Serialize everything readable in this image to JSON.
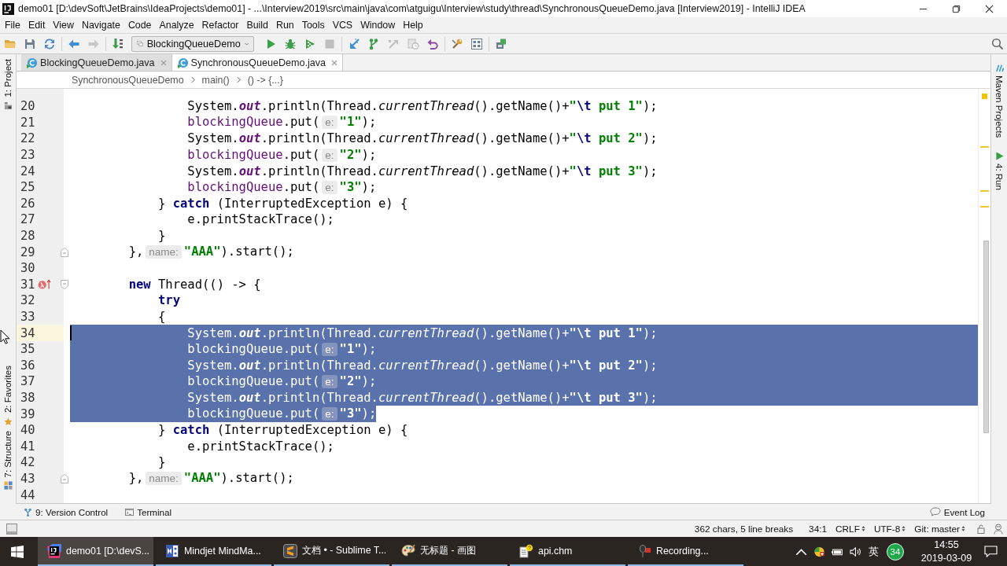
{
  "window": {
    "title": "demo01 [D:\\devSoft\\JetBrains\\IdeaProjects\\demo01] - ...\\Interview2019\\src\\main\\java\\com\\atguigu\\Interview\\study\\thread\\SynchronousQueueDemo.java [Interview2019] - IntelliJ IDEA"
  },
  "menu": [
    "File",
    "Edit",
    "View",
    "Navigate",
    "Code",
    "Analyze",
    "Refactor",
    "Build",
    "Run",
    "Tools",
    "VCS",
    "Window",
    "Help"
  ],
  "toolbar": {
    "run_config": "BlockingQueueDemo"
  },
  "left_tool_strip": {
    "top": [
      {
        "label": "1: Project",
        "kind": "project"
      }
    ],
    "bottom": [
      {
        "label": "2: Favorites",
        "kind": "favorites"
      },
      {
        "label": "7: Structure",
        "kind": "structure"
      }
    ]
  },
  "editor_tabs": [
    {
      "label": "BlockingQueueDemo.java",
      "selected": false
    },
    {
      "label": "SynchronousQueueDemo.java",
      "selected": true
    }
  ],
  "breadcrumbs": [
    "SynchronousQueueDemo",
    "main()",
    "() -> {...}"
  ],
  "editor": {
    "lines": [
      {
        "number": "20",
        "selected": false,
        "current": false,
        "tokens": [
          {
            "text": "                System.",
            "kind": "plain"
          },
          {
            "text": "out",
            "kind": "field"
          },
          {
            "text": ".println(Thread.",
            "kind": "plain"
          },
          {
            "text": "currentThread",
            "kind": "static"
          },
          {
            "text": "().getName()+",
            "kind": "plain"
          },
          {
            "text": "\"",
            "kind": "string"
          },
          {
            "text": "\\t",
            "kind": "escape"
          },
          {
            "text": " put 1\"",
            "kind": "string"
          },
          {
            "text": ");",
            "kind": "plain"
          }
        ]
      },
      {
        "number": "21",
        "selected": false,
        "current": false,
        "tokens": [
          {
            "text": "                blockingQueue",
            "kind": "captured"
          },
          {
            "text": ".put(",
            "kind": "plain"
          },
          {
            "text": "e:",
            "kind": "hint"
          },
          {
            "text": "\"1\"",
            "kind": "string"
          },
          {
            "text": ");",
            "kind": "plain"
          }
        ]
      },
      {
        "number": "22",
        "selected": false,
        "current": false,
        "tokens": [
          {
            "text": "                System.",
            "kind": "plain"
          },
          {
            "text": "out",
            "kind": "field"
          },
          {
            "text": ".println(Thread.",
            "kind": "plain"
          },
          {
            "text": "currentThread",
            "kind": "static"
          },
          {
            "text": "().getName()+",
            "kind": "plain"
          },
          {
            "text": "\"",
            "kind": "string"
          },
          {
            "text": "\\t",
            "kind": "escape"
          },
          {
            "text": " put 2\"",
            "kind": "string"
          },
          {
            "text": ");",
            "kind": "plain"
          }
        ]
      },
      {
        "number": "23",
        "selected": false,
        "current": false,
        "tokens": [
          {
            "text": "                blockingQueue",
            "kind": "captured"
          },
          {
            "text": ".put(",
            "kind": "plain"
          },
          {
            "text": "e:",
            "kind": "hint"
          },
          {
            "text": "\"2\"",
            "kind": "string"
          },
          {
            "text": ");",
            "kind": "plain"
          }
        ]
      },
      {
        "number": "24",
        "selected": false,
        "current": false,
        "tokens": [
          {
            "text": "                System.",
            "kind": "plain"
          },
          {
            "text": "out",
            "kind": "field"
          },
          {
            "text": ".println(Thread.",
            "kind": "plain"
          },
          {
            "text": "currentThread",
            "kind": "static"
          },
          {
            "text": "().getName()+",
            "kind": "plain"
          },
          {
            "text": "\"",
            "kind": "string"
          },
          {
            "text": "\\t",
            "kind": "escape"
          },
          {
            "text": " put 3\"",
            "kind": "string"
          },
          {
            "text": ");",
            "kind": "plain"
          }
        ]
      },
      {
        "number": "25",
        "selected": false,
        "current": false,
        "tokens": [
          {
            "text": "                blockingQueue",
            "kind": "captured"
          },
          {
            "text": ".put(",
            "kind": "plain"
          },
          {
            "text": "e:",
            "kind": "hint"
          },
          {
            "text": "\"3\"",
            "kind": "string"
          },
          {
            "text": ");",
            "kind": "plain"
          }
        ]
      },
      {
        "number": "26",
        "selected": false,
        "current": false,
        "tokens": [
          {
            "text": "            } ",
            "kind": "plain"
          },
          {
            "text": "catch",
            "kind": "keyword"
          },
          {
            "text": " (InterruptedException e) {",
            "kind": "plain"
          }
        ]
      },
      {
        "number": "27",
        "selected": false,
        "current": false,
        "tokens": [
          {
            "text": "                e.printStackTrace();",
            "kind": "plain"
          }
        ]
      },
      {
        "number": "28",
        "selected": false,
        "current": false,
        "tokens": [
          {
            "text": "            }",
            "kind": "plain"
          }
        ]
      },
      {
        "number": "29",
        "selected": false,
        "current": false,
        "gutter_icons": [
          {
            "kind": "fold_end"
          }
        ],
        "tokens": [
          {
            "text": "        },",
            "kind": "plain"
          },
          {
            "text": "name:",
            "kind": "hint"
          },
          {
            "text": "\"AAA\"",
            "kind": "string"
          },
          {
            "text": ").start();",
            "kind": "plain"
          }
        ]
      },
      {
        "number": "30",
        "selected": false,
        "current": false
      },
      {
        "number": "31",
        "selected": false,
        "current": false,
        "gutter_icons": [
          {
            "kind": "lambda"
          },
          {
            "kind": "fold_start"
          }
        ],
        "tokens": [
          {
            "text": "        new",
            "kind": "keyword"
          },
          {
            "text": " Thread(() -> {",
            "kind": "plain"
          }
        ]
      },
      {
        "number": "32",
        "selected": false,
        "current": false,
        "tokens": [
          {
            "text": "            try",
            "kind": "keyword"
          }
        ]
      },
      {
        "number": "33",
        "selected": false,
        "current": false,
        "tokens": [
          {
            "text": "            {",
            "kind": "plain"
          }
        ]
      },
      {
        "number": "34",
        "selected": true,
        "current": true,
        "tokens": [
          {
            "text": "                System.",
            "kind": "plain"
          },
          {
            "text": "out",
            "kind": "field"
          },
          {
            "text": ".println(Thread.",
            "kind": "plain"
          },
          {
            "text": "currentThread",
            "kind": "static"
          },
          {
            "text": "().getName()+",
            "kind": "plain"
          },
          {
            "text": "\"",
            "kind": "string"
          },
          {
            "text": "\\t",
            "kind": "escape"
          },
          {
            "text": " put 1\"",
            "kind": "string"
          },
          {
            "text": ");",
            "kind": "plain"
          }
        ]
      },
      {
        "number": "35",
        "selected": true,
        "current": false,
        "tokens": [
          {
            "text": "                blockingQueue",
            "kind": "captured"
          },
          {
            "text": ".put(",
            "kind": "plain"
          },
          {
            "text": "e:",
            "kind": "hint"
          },
          {
            "text": "\"1\"",
            "kind": "string"
          },
          {
            "text": ");",
            "kind": "plain"
          }
        ]
      },
      {
        "number": "36",
        "selected": true,
        "current": false,
        "tokens": [
          {
            "text": "                System.",
            "kind": "plain"
          },
          {
            "text": "out",
            "kind": "field"
          },
          {
            "text": ".println(Thread.",
            "kind": "plain"
          },
          {
            "text": "currentThread",
            "kind": "static"
          },
          {
            "text": "().getName()+",
            "kind": "plain"
          },
          {
            "text": "\"",
            "kind": "string"
          },
          {
            "text": "\\t",
            "kind": "escape"
          },
          {
            "text": " put 2\"",
            "kind": "string"
          },
          {
            "text": ");",
            "kind": "plain"
          }
        ]
      },
      {
        "number": "37",
        "selected": true,
        "current": false,
        "tokens": [
          {
            "text": "                blockingQueue",
            "kind": "captured"
          },
          {
            "text": ".put(",
            "kind": "plain"
          },
          {
            "text": "e:",
            "kind": "hint"
          },
          {
            "text": "\"2\"",
            "kind": "string"
          },
          {
            "text": ");",
            "kind": "plain"
          }
        ]
      },
      {
        "number": "38",
        "selected": true,
        "current": false,
        "tokens": [
          {
            "text": "                System.",
            "kind": "plain"
          },
          {
            "text": "out",
            "kind": "field"
          },
          {
            "text": ".println(Thread.",
            "kind": "plain"
          },
          {
            "text": "currentThread",
            "kind": "static"
          },
          {
            "text": "().getName()+",
            "kind": "plain"
          },
          {
            "text": "\"",
            "kind": "string"
          },
          {
            "text": "\\t",
            "kind": "escape"
          },
          {
            "text": " put 3\"",
            "kind": "string"
          },
          {
            "text": ");",
            "kind": "plain"
          }
        ]
      },
      {
        "number": "39",
        "selected": true,
        "current": false,
        "tokens": [
          {
            "text": "                blockingQueue",
            "kind": "captured"
          },
          {
            "text": ".put(",
            "kind": "plain"
          },
          {
            "text": "e:",
            "kind": "hint"
          },
          {
            "text": "\"3\"",
            "kind": "string"
          },
          {
            "text": ");",
            "kind": "plain"
          }
        ]
      },
      {
        "number": "40",
        "selected": false,
        "current": false,
        "tokens": [
          {
            "text": "            } ",
            "kind": "plain"
          },
          {
            "text": "catch",
            "kind": "keyword"
          },
          {
            "text": " (InterruptedException e) {",
            "kind": "plain"
          }
        ]
      },
      {
        "number": "41",
        "selected": false,
        "current": false,
        "tokens": [
          {
            "text": "                e.printStackTrace();",
            "kind": "plain"
          }
        ]
      },
      {
        "number": "42",
        "selected": false,
        "current": false,
        "tokens": [
          {
            "text": "            }",
            "kind": "plain"
          }
        ]
      },
      {
        "number": "43",
        "selected": false,
        "current": false,
        "gutter_icons": [
          {
            "kind": "fold_end"
          }
        ],
        "tokens": [
          {
            "text": "        },",
            "kind": "plain"
          },
          {
            "text": "name:",
            "kind": "hint"
          },
          {
            "text": "\"AAA\"",
            "kind": "string"
          },
          {
            "text": ").start();",
            "kind": "plain"
          }
        ]
      },
      {
        "number": "44",
        "selected": false,
        "current": false
      }
    ]
  },
  "right_tool_strip": [
    {
      "label": "Maven Projects",
      "kind": "maven"
    },
    {
      "label": "4: Run",
      "kind": "run"
    }
  ],
  "tool_window_bar": {
    "left": [
      {
        "label": "9: Version Control",
        "kind": "vcs"
      },
      {
        "label": "Terminal",
        "kind": "terminal"
      }
    ],
    "right": [
      {
        "label": "Event Log",
        "kind": "event_log"
      }
    ]
  },
  "status_bar": {
    "selection_info": "362 chars, 5 line breaks",
    "caret_position": "34:1",
    "widgets": [
      "CRLF",
      "UTF-8",
      "Git: master"
    ]
  },
  "taskbar": {
    "items": [
      {
        "label": "demo01 [D:\\devS...",
        "kind": "intellij",
        "selected": true
      },
      {
        "label": "Mindjet MindMa...",
        "kind": "mindjet",
        "selected": false
      },
      {
        "label": "文档 • - Sublime T...",
        "kind": "sublime",
        "selected": false
      },
      {
        "label": "无标题 - 画图",
        "kind": "paint",
        "selected": false
      },
      {
        "label": "api.chm",
        "kind": "chm",
        "selected": false
      },
      {
        "label": "Recording...",
        "kind": "recorder",
        "selected": false
      }
    ],
    "tray": {
      "input_method": "英",
      "badge": "34",
      "time": "14:55",
      "date": "2019-03-09"
    }
  }
}
